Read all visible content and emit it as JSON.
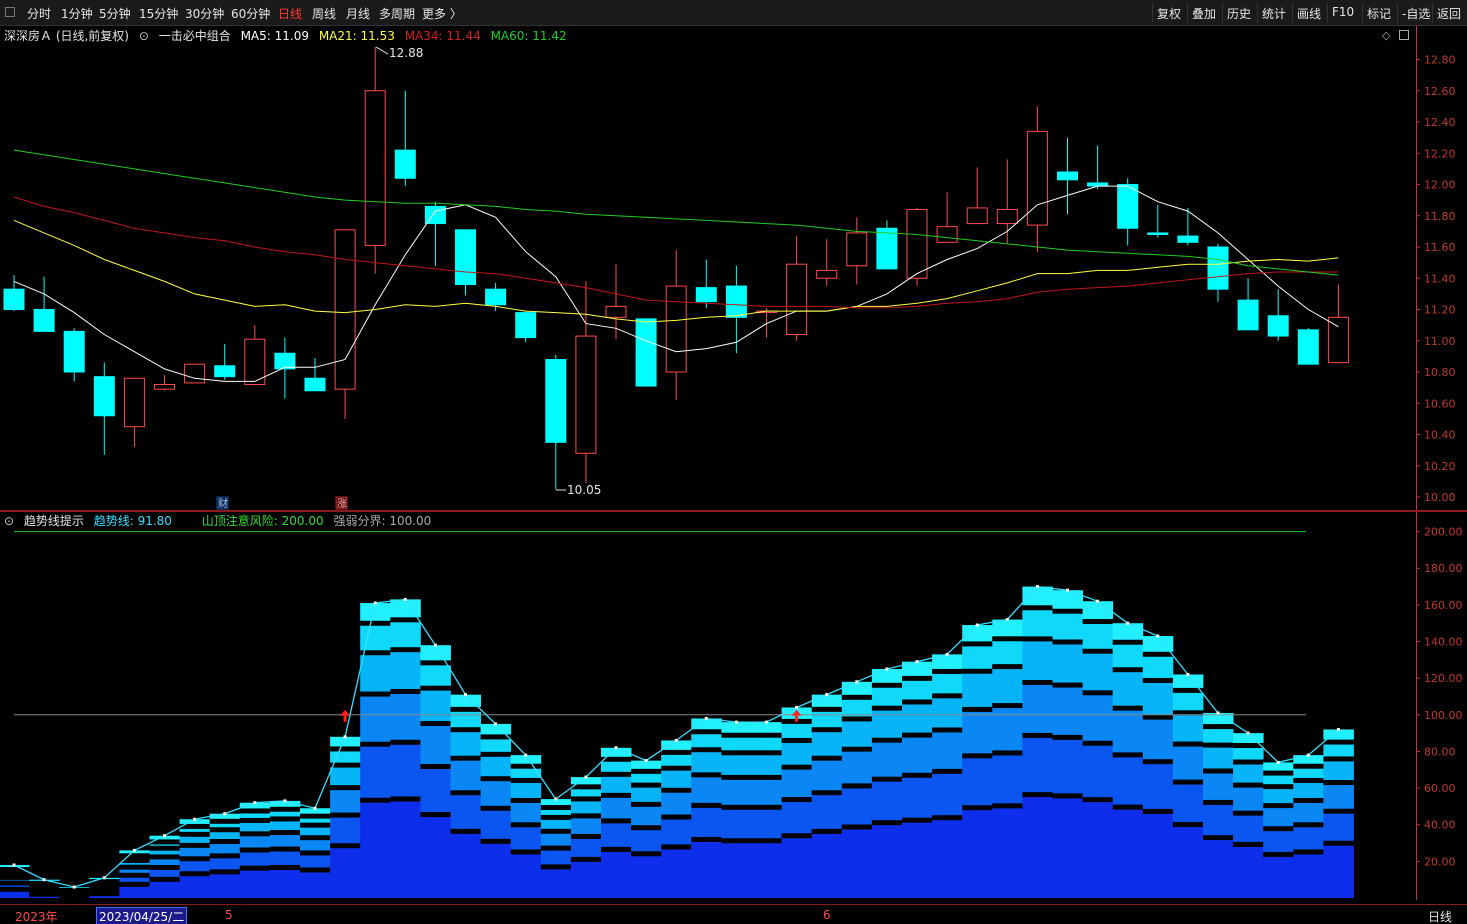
{
  "toolbar": {
    "periods": [
      "分时",
      "1分钟",
      "5分钟",
      "15分钟",
      "30分钟",
      "60分钟",
      "日线",
      "周线",
      "月线",
      "多周期",
      "更多 〉"
    ],
    "active_period": "日线",
    "right_buttons": [
      "复权",
      "叠加",
      "历史",
      "统计",
      "画线",
      "F10",
      "标记",
      "-自选",
      "返回"
    ]
  },
  "main_legend": {
    "title": "深深房Ａ (日线,前复权)",
    "indicator_name": "一击必中组合",
    "ma5": "MA5: 11.09",
    "ma21": "MA21: 11.53",
    "ma34": "MA34: 11.44",
    "ma60": "MA60: 11.42"
  },
  "sub_legend": {
    "title": "趋势线提示",
    "trend": "趋势线: 91.80",
    "risk": "山顶注意风险: 200.00",
    "boundary": "强弱分界: 100.00"
  },
  "markers": {
    "finance": "财",
    "rise": "涨",
    "high_label": "12.88",
    "low_label": "10.05"
  },
  "bottom_bar": {
    "year": "2023年",
    "cursor_date": "2023/04/25/二",
    "month5": "5",
    "month6": "6",
    "period": "日线"
  },
  "colors": {
    "bg": "#000000",
    "up": "#ff4a4a",
    "down": "#00ffff",
    "ma5": "#ffffff",
    "ma21": "#ffff44",
    "ma34": "#c01818",
    "ma60": "#22cc22",
    "axis": "#c0392b"
  },
  "chart_data": [
    {
      "type": "candlestick",
      "title": "深深房Ａ (日线,前复权)",
      "y_ticks": [
        "12.80",
        "12.60",
        "12.40",
        "12.20",
        "12.00",
        "11.80",
        "11.60",
        "11.40",
        "11.20",
        "11.00",
        "10.80",
        "10.60",
        "10.40",
        "10.20",
        "10.00"
      ],
      "ylim": [
        9.98,
        12.94
      ],
      "candles": [
        {
          "o": 11.33,
          "h": 11.42,
          "l": 11.19,
          "c": 11.2
        },
        {
          "o": 11.2,
          "h": 11.41,
          "l": 11.12,
          "c": 11.06
        },
        {
          "o": 11.06,
          "h": 11.08,
          "l": 10.74,
          "c": 10.8
        },
        {
          "o": 10.77,
          "h": 10.86,
          "l": 10.27,
          "c": 10.52
        },
        {
          "o": 10.45,
          "h": 10.76,
          "l": 10.32,
          "c": 10.76
        },
        {
          "o": 10.69,
          "h": 10.78,
          "l": 10.68,
          "c": 10.72
        },
        {
          "o": 10.73,
          "h": 10.85,
          "l": 10.73,
          "c": 10.85
        },
        {
          "o": 10.84,
          "h": 10.98,
          "l": 10.75,
          "c": 10.77
        },
        {
          "o": 10.72,
          "h": 11.1,
          "l": 10.72,
          "c": 11.01
        },
        {
          "o": 10.92,
          "h": 11.02,
          "l": 10.63,
          "c": 10.82
        },
        {
          "o": 10.76,
          "h": 10.89,
          "l": 10.68,
          "c": 10.68
        },
        {
          "o": 10.69,
          "h": 11.33,
          "l": 10.5,
          "c": 11.71
        },
        {
          "o": 11.61,
          "h": 12.88,
          "l": 11.43,
          "c": 12.6
        },
        {
          "o": 12.22,
          "h": 12.6,
          "l": 11.99,
          "c": 12.04
        },
        {
          "o": 11.86,
          "h": 11.89,
          "l": 11.48,
          "c": 11.75
        },
        {
          "o": 11.71,
          "h": 11.71,
          "l": 11.29,
          "c": 11.36
        },
        {
          "o": 11.33,
          "h": 11.37,
          "l": 11.19,
          "c": 11.23
        },
        {
          "o": 11.18,
          "h": 11.19,
          "l": 10.99,
          "c": 11.02
        },
        {
          "o": 10.88,
          "h": 10.91,
          "l": 10.05,
          "c": 10.35
        },
        {
          "o": 10.28,
          "h": 11.38,
          "l": 10.09,
          "c": 11.03
        },
        {
          "o": 11.15,
          "h": 11.49,
          "l": 11.01,
          "c": 11.22
        },
        {
          "o": 11.14,
          "h": 11.13,
          "l": 10.93,
          "c": 10.71
        },
        {
          "o": 10.8,
          "h": 11.58,
          "l": 10.62,
          "c": 11.35
        },
        {
          "o": 11.34,
          "h": 11.52,
          "l": 11.21,
          "c": 11.25
        },
        {
          "o": 11.35,
          "h": 11.48,
          "l": 10.92,
          "c": 11.15
        },
        {
          "o": 11.19,
          "h": 11.21,
          "l": 11.02,
          "c": 11.19
        },
        {
          "o": 11.04,
          "h": 11.67,
          "l": 11.0,
          "c": 11.49
        },
        {
          "o": 11.4,
          "h": 11.65,
          "l": 11.35,
          "c": 11.45
        },
        {
          "o": 11.48,
          "h": 11.79,
          "l": 11.36,
          "c": 11.69
        },
        {
          "o": 11.72,
          "h": 11.77,
          "l": 11.47,
          "c": 11.46
        },
        {
          "o": 11.4,
          "h": 11.85,
          "l": 11.35,
          "c": 11.84
        },
        {
          "o": 11.63,
          "h": 11.95,
          "l": 11.63,
          "c": 11.73
        },
        {
          "o": 11.75,
          "h": 12.11,
          "l": 11.75,
          "c": 11.85
        },
        {
          "o": 11.75,
          "h": 12.16,
          "l": 11.62,
          "c": 11.84
        },
        {
          "o": 11.74,
          "h": 12.5,
          "l": 11.57,
          "c": 12.34
        },
        {
          "o": 12.08,
          "h": 12.3,
          "l": 11.81,
          "c": 12.03
        },
        {
          "o": 12.01,
          "h": 12.25,
          "l": 11.97,
          "c": 11.99
        },
        {
          "o": 12.0,
          "h": 12.04,
          "l": 11.61,
          "c": 11.72
        },
        {
          "o": 11.69,
          "h": 11.87,
          "l": 11.66,
          "c": 11.68
        },
        {
          "o": 11.67,
          "h": 11.85,
          "l": 11.61,
          "c": 11.63
        },
        {
          "o": 11.6,
          "h": 11.62,
          "l": 11.25,
          "c": 11.33
        },
        {
          "o": 11.26,
          "h": 11.4,
          "l": 11.11,
          "c": 11.07
        },
        {
          "o": 11.16,
          "h": 11.33,
          "l": 11.0,
          "c": 11.03
        },
        {
          "o": 11.07,
          "h": 11.08,
          "l": 10.86,
          "c": 10.85
        },
        {
          "o": 10.86,
          "h": 11.36,
          "l": 10.86,
          "c": 11.15
        }
      ],
      "ma_series": [
        {
          "name": "MA5",
          "values": [
            11.38,
            11.3,
            11.18,
            11.04,
            10.93,
            10.82,
            10.76,
            10.74,
            10.74,
            10.83,
            10.83,
            10.88,
            11.23,
            11.55,
            11.83,
            11.87,
            11.79,
            11.57,
            11.41,
            11.11,
            11.08,
            11.0,
            10.93,
            10.95,
            10.99,
            11.11,
            11.19,
            11.19,
            11.22,
            11.3,
            11.43,
            11.52,
            11.59,
            11.7,
            11.87,
            11.93,
            11.99,
            11.99,
            11.89,
            11.83,
            11.69,
            11.52,
            11.35,
            11.2,
            11.09
          ]
        },
        {
          "name": "MA21",
          "values": [
            11.77,
            11.69,
            11.61,
            11.52,
            11.45,
            11.38,
            11.3,
            11.26,
            11.22,
            11.23,
            11.19,
            11.18,
            11.2,
            11.23,
            11.22,
            11.24,
            11.22,
            11.19,
            11.18,
            11.17,
            11.14,
            11.12,
            11.13,
            11.15,
            11.16,
            11.19,
            11.19,
            11.19,
            11.22,
            11.22,
            11.24,
            11.27,
            11.32,
            11.37,
            11.43,
            11.43,
            11.45,
            11.45,
            11.47,
            11.49,
            11.49,
            11.51,
            11.52,
            11.51,
            11.53
          ]
        },
        {
          "name": "MA34",
          "values": [
            11.92,
            11.86,
            11.82,
            11.77,
            11.72,
            11.69,
            11.66,
            11.64,
            11.6,
            11.57,
            11.55,
            11.52,
            11.5,
            11.48,
            11.46,
            11.44,
            11.43,
            11.4,
            11.37,
            11.34,
            11.3,
            11.26,
            11.25,
            11.24,
            11.23,
            11.22,
            11.22,
            11.22,
            11.21,
            11.21,
            11.22,
            11.24,
            11.25,
            11.27,
            11.31,
            11.33,
            11.34,
            11.35,
            11.37,
            11.39,
            11.41,
            11.43,
            11.44,
            11.44,
            11.44
          ]
        },
        {
          "name": "MA60",
          "values": [
            12.22,
            12.19,
            12.16,
            12.13,
            12.1,
            12.07,
            12.04,
            12.01,
            11.98,
            11.95,
            11.92,
            11.9,
            11.89,
            11.88,
            11.88,
            11.87,
            11.86,
            11.84,
            11.83,
            11.81,
            11.8,
            11.79,
            11.78,
            11.77,
            11.76,
            11.75,
            11.74,
            11.72,
            11.7,
            11.69,
            11.68,
            11.66,
            11.64,
            11.62,
            11.6,
            11.58,
            11.57,
            11.56,
            11.55,
            11.54,
            11.52,
            11.48,
            11.46,
            11.44,
            11.42
          ]
        }
      ]
    },
    {
      "type": "area",
      "title": "趋势线提示",
      "y_ticks": [
        "200.00",
        "180.00",
        "160.00",
        "140.00",
        "120.00",
        "100.00",
        "80.00",
        "60.00",
        "40.00",
        "20.00"
      ],
      "ylim": [
        0,
        205
      ],
      "reference_lines": [
        200,
        100
      ],
      "signal_arrows_at_index": [
        11,
        26
      ],
      "series": [
        {
          "name": "趋势线",
          "values": [
            18,
            10,
            6,
            11,
            26,
            34,
            43,
            46,
            52,
            53,
            49,
            88,
            161,
            163,
            138,
            111,
            95,
            78,
            54,
            66,
            82,
            75,
            86,
            98,
            96,
            96,
            104,
            111,
            118,
            125,
            129,
            133,
            149,
            152,
            170,
            168,
            162,
            150,
            143,
            122,
            101,
            90,
            74,
            78,
            92
          ]
        }
      ]
    }
  ]
}
